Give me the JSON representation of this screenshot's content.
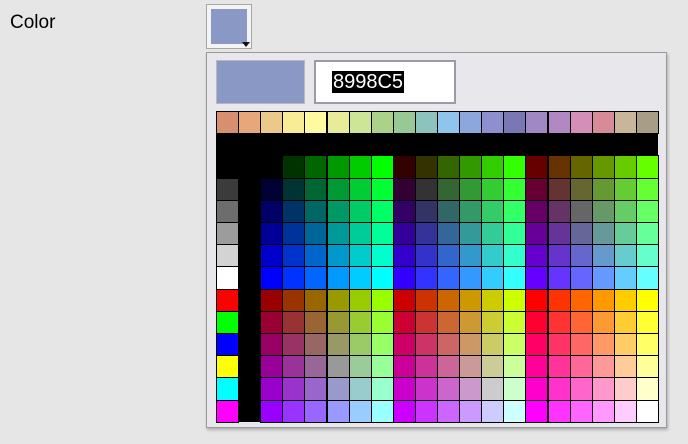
{
  "field": {
    "label": "Color"
  },
  "current_color": "#8998C5",
  "picker": {
    "hex_value": "8998C5",
    "top_row": [
      "#D78F70",
      "#E8A77A",
      "#EBC98A",
      "#F8EC96",
      "#FFF9A0",
      "#E8EB97",
      "#CDE596",
      "#ACD28A",
      "#98C995",
      "#8DC3BD",
      "#8FC4EC",
      "#8BA7DB",
      "#8D8FCE",
      "#7978B4",
      "#9F88C4",
      "#B188C3",
      "#D48FB9",
      "#D78B99",
      "#C8B59A",
      "#A89E87"
    ],
    "grays": [
      "#3B3B3B",
      "#6D6D6D",
      "#9C9C9C",
      "#D3D3D3",
      "#FFFFFF"
    ],
    "primaries": [
      "#FF0000",
      "#00FF00",
      "#0000FF",
      "#FFFF00",
      "#00FFFF",
      "#FF00FF"
    ]
  }
}
